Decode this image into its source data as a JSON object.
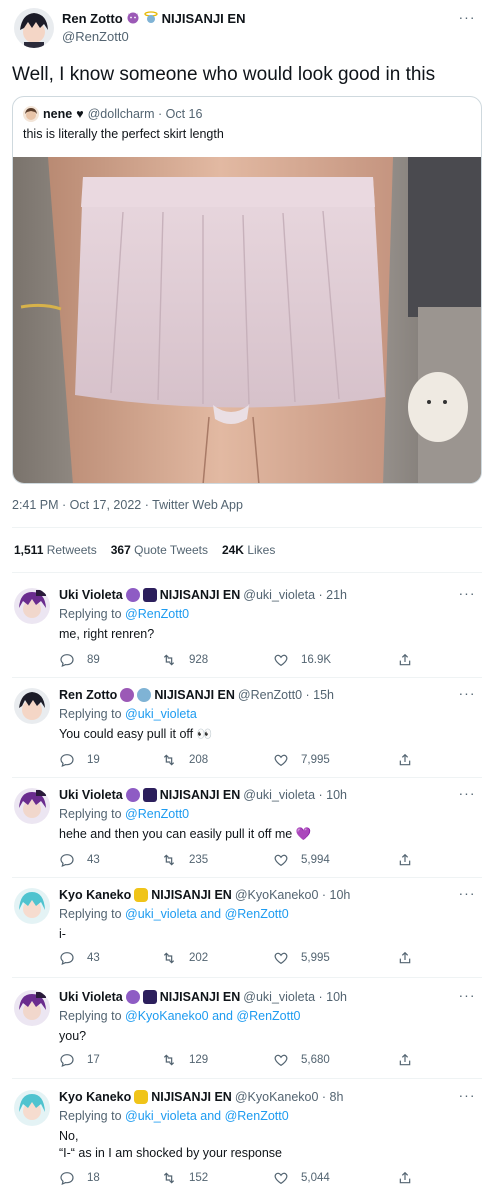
{
  "main_tweet": {
    "author_name": "Ren Zotto",
    "author_suffix": "NIJISANJI EN",
    "handle": "@RenZott0",
    "text": "Well, I know someone who would look good in this",
    "quote": {
      "author_name": "nene",
      "heart": "♥",
      "handle_meta": "@dollcharm · Oct 16",
      "text": "this is literally the perfect skirt length"
    },
    "timestamp": "2:41 PM · Oct 17, 2022 · Twitter Web App",
    "stats": {
      "retweets_count": "1,511",
      "retweets_label": "Retweets",
      "quotes_count": "367",
      "quotes_label": "Quote Tweets",
      "likes_count": "24K",
      "likes_label": "Likes"
    }
  },
  "replies": [
    {
      "name": "Uki Violeta",
      "suffix": "NIJISANJI EN",
      "meta": "@uki_violeta · 21h",
      "replying_label": "Replying to",
      "mentions": "@RenZott0",
      "text": "me, right renren?",
      "replies": "89",
      "retweets": "928",
      "likes": "16.9K"
    },
    {
      "name": "Ren Zotto",
      "suffix": "NIJISANJI EN",
      "meta": "@RenZott0 · 15h",
      "replying_label": "Replying to",
      "mentions": "@uki_violeta",
      "text": "You could easy pull it off 👀",
      "replies": "19",
      "retweets": "208",
      "likes": "7,995"
    },
    {
      "name": "Uki Violeta",
      "suffix": "NIJISANJI EN",
      "meta": "@uki_violeta · 10h",
      "replying_label": "Replying to",
      "mentions": "@RenZott0",
      "text": "hehe and then you can easily pull it off me 💜",
      "replies": "43",
      "retweets": "235",
      "likes": "5,994"
    },
    {
      "name": "Kyo Kaneko",
      "suffix": "NIJISANJI EN",
      "meta": "@KyoKaneko0 · 10h",
      "replying_label": "Replying to",
      "mentions": "@uki_violeta and @RenZott0",
      "text": "i-",
      "replies": "43",
      "retweets": "202",
      "likes": "5,995"
    },
    {
      "name": "Uki Violeta",
      "suffix": "NIJISANJI EN",
      "meta": "@uki_violeta · 10h",
      "replying_label": "Replying to",
      "mentions": "@KyoKaneko0 and @RenZott0",
      "text": "you?",
      "replies": "17",
      "retweets": "129",
      "likes": "5,680"
    },
    {
      "name": "Kyo Kaneko",
      "suffix": "NIJISANJI EN",
      "meta": "@KyoKaneko0 · 8h",
      "replying_label": "Replying to",
      "mentions": "@uki_violeta and @RenZott0",
      "text": "No,",
      "text2": "“I-“ as in I am shocked by your response",
      "replies": "18",
      "retweets": "152",
      "likes": "5,044"
    }
  ],
  "colors": {
    "link": "#1d9bf0",
    "secondary_text": "#536471",
    "border": "#cfd9de"
  },
  "icons": [
    "more-icon",
    "reply-icon",
    "retweet-icon",
    "like-icon",
    "share-icon"
  ]
}
